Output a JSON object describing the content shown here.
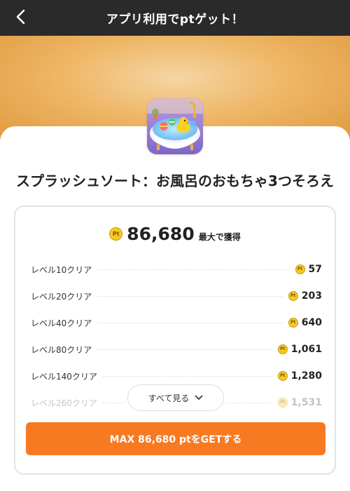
{
  "header": {
    "title": "アプリ利用でptゲット！",
    "back_icon": "chevron-left-icon"
  },
  "banner": {
    "color_top": "#f6d5a3",
    "color_edge": "#e09a3e"
  },
  "app": {
    "icon": "app-icon-bathtub-duck",
    "title": "スプラッシュソート：お風呂のおもちゃ3つそろえ"
  },
  "reward": {
    "total": "86,680",
    "total_suffix": "最大で獲得",
    "coin_label": "Pt",
    "rows": [
      {
        "label": "レベル10クリア",
        "points": "57"
      },
      {
        "label": "レベル20クリア",
        "points": "203"
      },
      {
        "label": "レベル40クリア",
        "points": "640"
      },
      {
        "label": "レベル80クリア",
        "points": "1,061"
      },
      {
        "label": "レベル140クリア",
        "points": "1,280"
      },
      {
        "label": "レベル260クリア",
        "points": "1,531"
      }
    ],
    "see_all_label": "すべて見る",
    "see_all_icon": "chevron-down-icon"
  },
  "cta": {
    "label": "MAX 86,680 ptをGETする",
    "color": "#f77a22"
  }
}
